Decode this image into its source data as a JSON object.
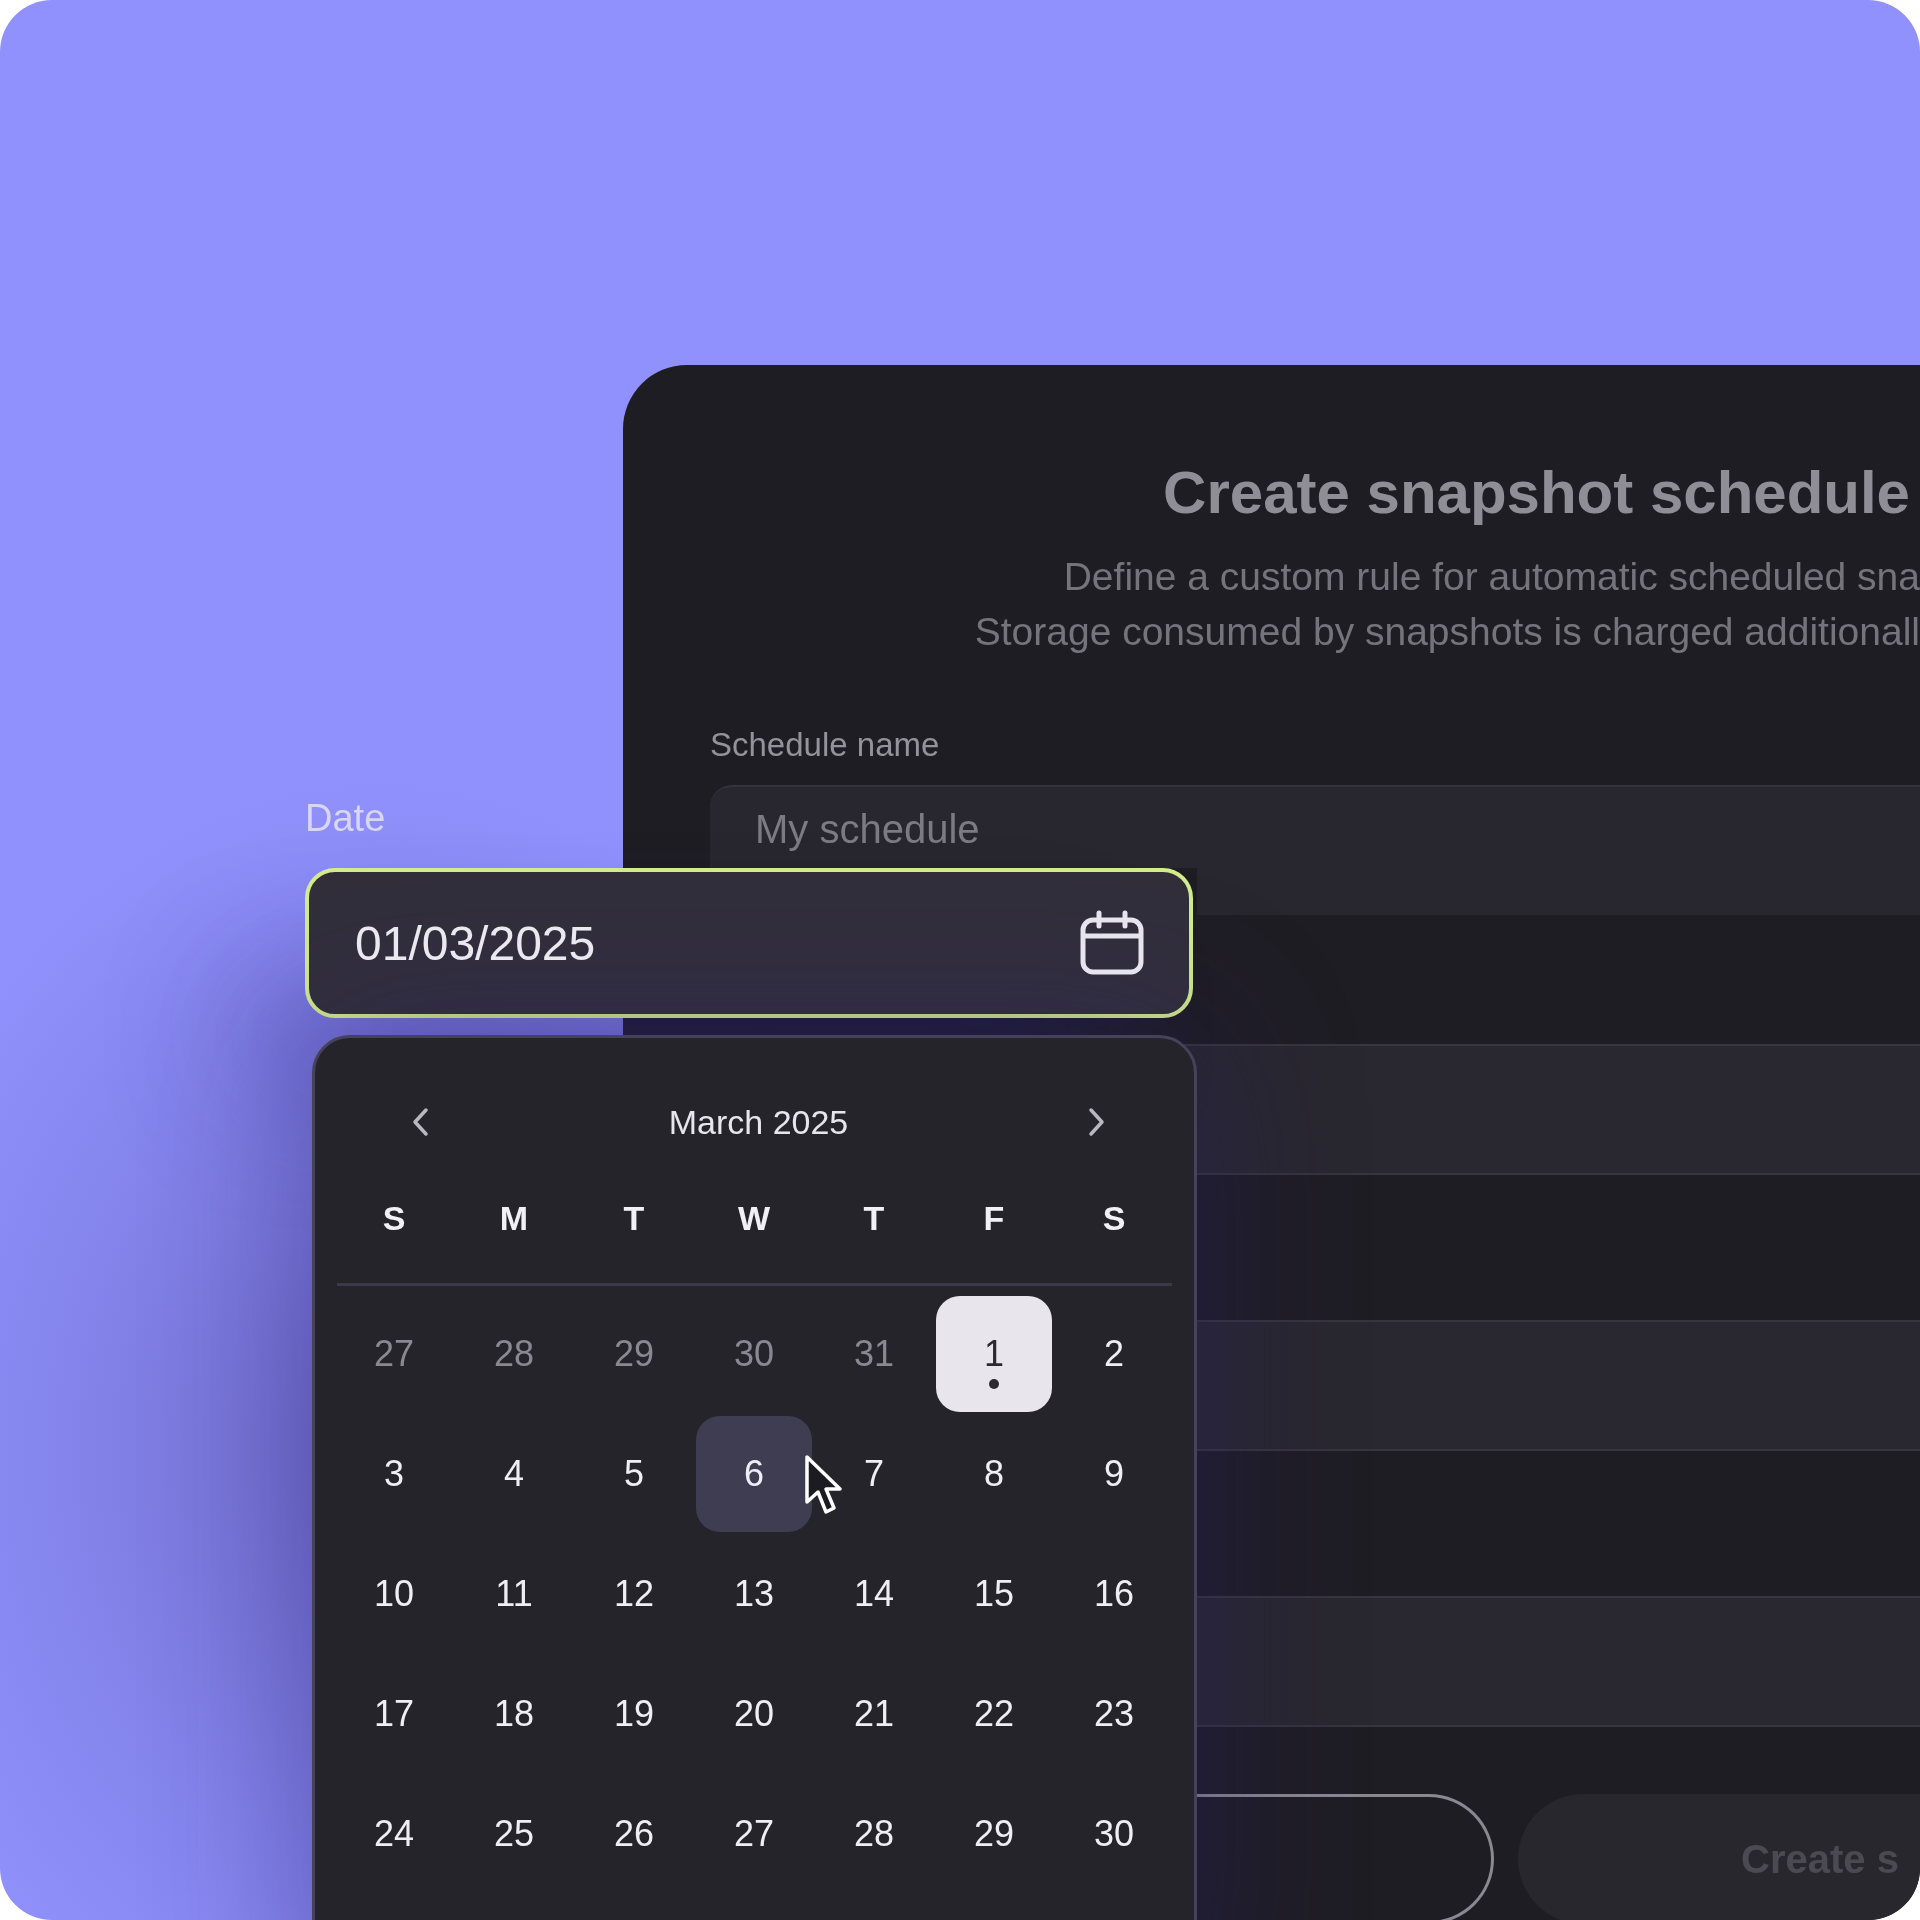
{
  "dialog": {
    "title": "Create snapshot schedule",
    "subtitle_lines": [
      "Define a custom rule for automatic scheduled sna",
      "Storage consumed by snapshots is charged additionall"
    ],
    "fields": [
      {
        "kind": "text",
        "label": "Schedule name",
        "placeholder": "My schedule"
      },
      {
        "kind": "blank"
      },
      {
        "kind": "blank"
      },
      {
        "kind": "blank"
      }
    ],
    "buttons": [
      {
        "kind": "outline"
      },
      {
        "kind": "primary",
        "label": "Create s",
        "disabled": true
      }
    ]
  },
  "date_picker": {
    "label": "Date",
    "value": "01/03/2025",
    "focused": true,
    "calendar": {
      "month": "March 2025",
      "weekdays": [
        "S",
        "M",
        "T",
        "W",
        "T",
        "F",
        "S"
      ],
      "days": [
        {
          "label": "27",
          "outside": true,
          "selected": false,
          "hovered": false,
          "marked": false
        },
        {
          "label": "28",
          "outside": true,
          "selected": false,
          "hovered": false,
          "marked": false
        },
        {
          "label": "29",
          "outside": true,
          "selected": false,
          "hovered": false,
          "marked": false
        },
        {
          "label": "30",
          "outside": true,
          "selected": false,
          "hovered": false,
          "marked": false
        },
        {
          "label": "31",
          "outside": true,
          "selected": false,
          "hovered": false,
          "marked": false
        },
        {
          "label": "1",
          "outside": false,
          "selected": true,
          "hovered": false,
          "marked": true
        },
        {
          "label": "2",
          "outside": false,
          "selected": false,
          "hovered": false,
          "marked": false
        },
        {
          "label": "3",
          "outside": false,
          "selected": false,
          "hovered": false,
          "marked": false
        },
        {
          "label": "4",
          "outside": false,
          "selected": false,
          "hovered": false,
          "marked": false
        },
        {
          "label": "5",
          "outside": false,
          "selected": false,
          "hovered": false,
          "marked": false
        },
        {
          "label": "6",
          "outside": false,
          "selected": false,
          "hovered": true,
          "marked": false
        },
        {
          "label": "7",
          "outside": false,
          "selected": false,
          "hovered": false,
          "marked": false
        },
        {
          "label": "8",
          "outside": false,
          "selected": false,
          "hovered": false,
          "marked": false
        },
        {
          "label": "9",
          "outside": false,
          "selected": false,
          "hovered": false,
          "marked": false
        },
        {
          "label": "10",
          "outside": false,
          "selected": false,
          "hovered": false,
          "marked": false
        },
        {
          "label": "11",
          "outside": false,
          "selected": false,
          "hovered": false,
          "marked": false
        },
        {
          "label": "12",
          "outside": false,
          "selected": false,
          "hovered": false,
          "marked": false
        },
        {
          "label": "13",
          "outside": false,
          "selected": false,
          "hovered": false,
          "marked": false
        },
        {
          "label": "14",
          "outside": false,
          "selected": false,
          "hovered": false,
          "marked": false
        },
        {
          "label": "15",
          "outside": false,
          "selected": false,
          "hovered": false,
          "marked": false
        },
        {
          "label": "16",
          "outside": false,
          "selected": false,
          "hovered": false,
          "marked": false
        },
        {
          "label": "17",
          "outside": false,
          "selected": false,
          "hovered": false,
          "marked": false
        },
        {
          "label": "18",
          "outside": false,
          "selected": false,
          "hovered": false,
          "marked": false
        },
        {
          "label": "19",
          "outside": false,
          "selected": false,
          "hovered": false,
          "marked": false
        },
        {
          "label": "20",
          "outside": false,
          "selected": false,
          "hovered": false,
          "marked": false
        },
        {
          "label": "21",
          "outside": false,
          "selected": false,
          "hovered": false,
          "marked": false
        },
        {
          "label": "22",
          "outside": false,
          "selected": false,
          "hovered": false,
          "marked": false
        },
        {
          "label": "23",
          "outside": false,
          "selected": false,
          "hovered": false,
          "marked": false
        },
        {
          "label": "24",
          "outside": false,
          "selected": false,
          "hovered": false,
          "marked": false
        },
        {
          "label": "25",
          "outside": false,
          "selected": false,
          "hovered": false,
          "marked": false
        },
        {
          "label": "26",
          "outside": false,
          "selected": false,
          "hovered": false,
          "marked": false
        },
        {
          "label": "27",
          "outside": false,
          "selected": false,
          "hovered": false,
          "marked": false
        },
        {
          "label": "28",
          "outside": false,
          "selected": false,
          "hovered": false,
          "marked": false
        },
        {
          "label": "29",
          "outside": false,
          "selected": false,
          "hovered": false,
          "marked": false
        },
        {
          "label": "30",
          "outside": false,
          "selected": false,
          "hovered": false,
          "marked": false
        }
      ]
    }
  }
}
